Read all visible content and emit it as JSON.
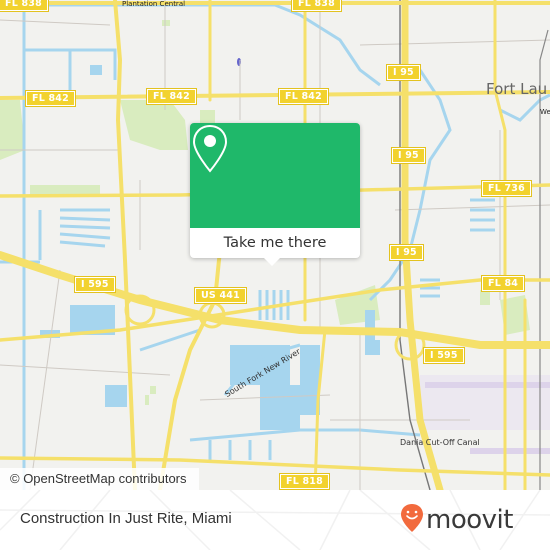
{
  "map": {
    "city_label": "Fort Lau",
    "small_labels": [
      "Plantation Central",
      "We"
    ],
    "river_labels": [
      "South Fork New River",
      "Dania Cut-Off Canal"
    ],
    "road_shields": [
      {
        "id": "fl838-a",
        "label": "FL 838"
      },
      {
        "id": "fl838-b",
        "label": "FL 838"
      },
      {
        "id": "fl842-a",
        "label": "FL 842"
      },
      {
        "id": "fl842-b",
        "label": "FL 842"
      },
      {
        "id": "fl842-c",
        "label": "FL 842"
      },
      {
        "id": "i95-a",
        "label": "I 95"
      },
      {
        "id": "i95-b",
        "label": "I 95"
      },
      {
        "id": "i95-c",
        "label": "I 95"
      },
      {
        "id": "fl736",
        "label": "FL 736"
      },
      {
        "id": "fl84",
        "label": "FL 84"
      },
      {
        "id": "i595-a",
        "label": "I 595"
      },
      {
        "id": "i595-b",
        "label": "I 595"
      },
      {
        "id": "us441",
        "label": "US 441"
      },
      {
        "id": "fl818",
        "label": "FL 818"
      }
    ],
    "colors": {
      "land": "#f2f2ef",
      "water": "#a6d5ee",
      "road_major": "#f5e06a",
      "park": "#d9ecbf",
      "minor_road": "#cfcac4"
    }
  },
  "popup": {
    "icon": "location-pin-icon",
    "action_label": "Take me there",
    "accent_color": "#1fb86a"
  },
  "attribution": "© OpenStreetMap contributors",
  "footer": {
    "place_title": "Construction In Just Rite, Miami",
    "brand_name": "moovit",
    "brand_icon": "moovit-pin-icon",
    "brand_color": "#f26a3d"
  }
}
